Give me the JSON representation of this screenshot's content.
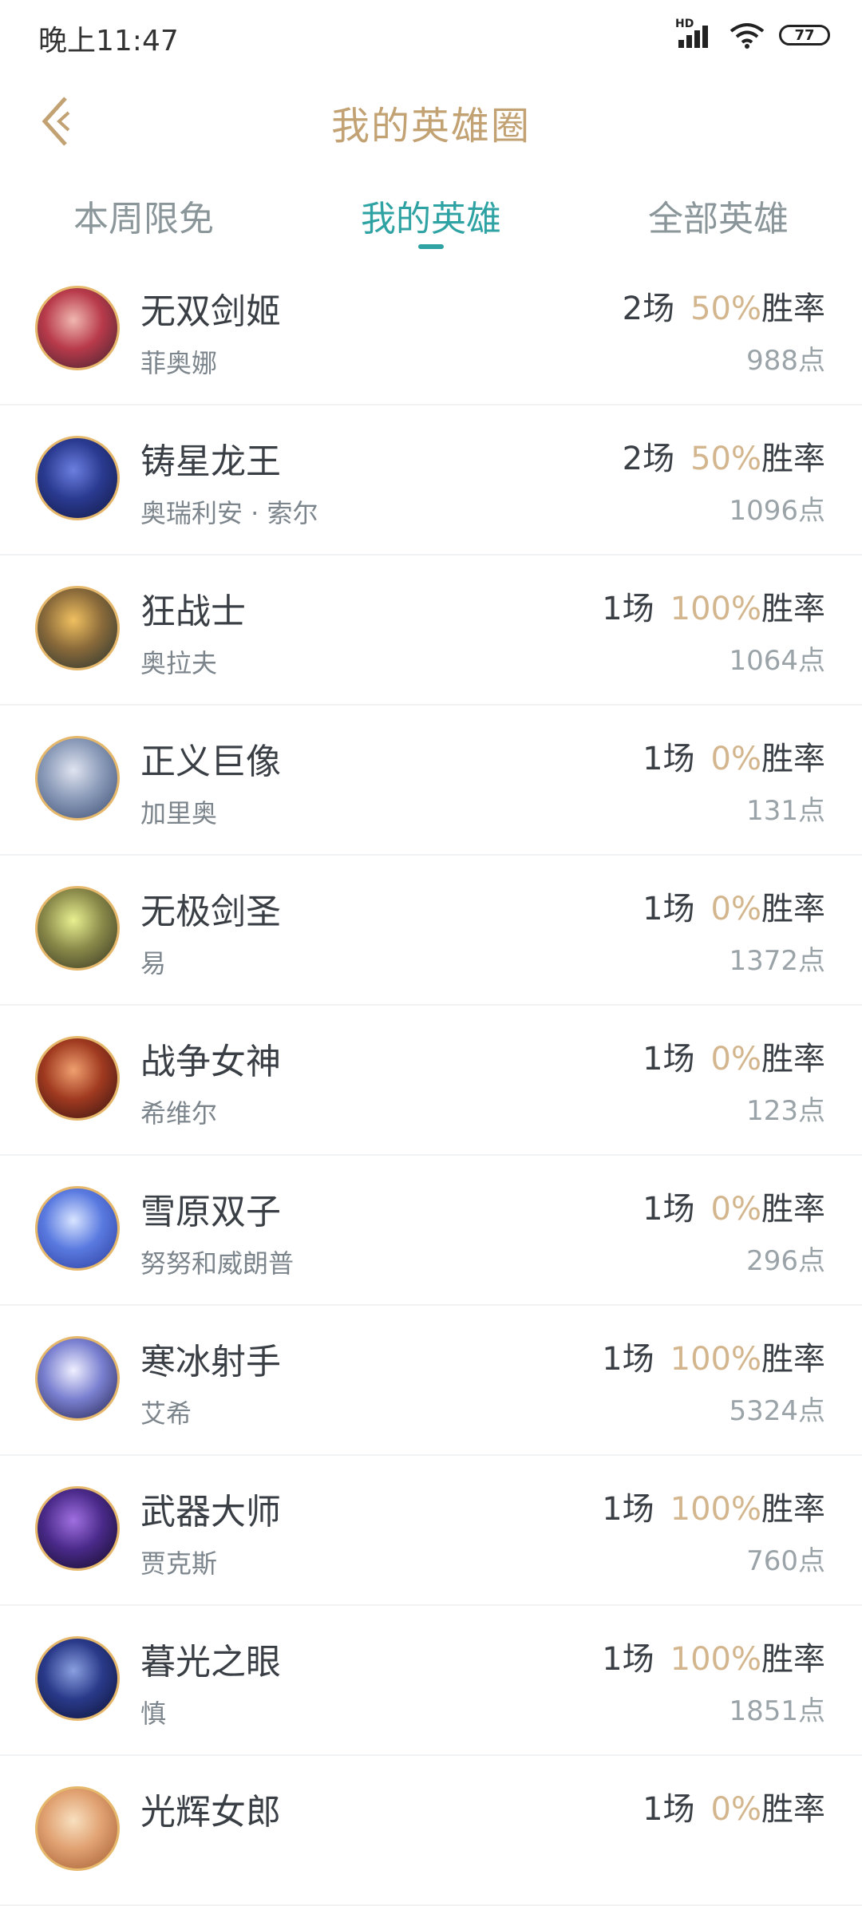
{
  "status_bar": {
    "time": "晚上11:47",
    "network_label": "HD",
    "battery": "77"
  },
  "header": {
    "title": "我的英雄圈"
  },
  "tabs": [
    {
      "label": "本周限免",
      "active": false
    },
    {
      "label": "我的英雄",
      "active": true
    },
    {
      "label": "全部英雄",
      "active": false
    }
  ],
  "stats_suffix": {
    "win_rate_label": "胜率"
  },
  "colors": {
    "accent_teal": "#2fa3a3",
    "accent_gold": "#c2a173",
    "rate_gold": "#d4b68e"
  },
  "heroes": [
    {
      "name": "无双剑姬",
      "sub": "菲奥娜",
      "games": "2场",
      "rate": "50%",
      "points": "988点",
      "avatar_colors": [
        "#f0b8b0",
        "#b83a4a",
        "#3a2230"
      ]
    },
    {
      "name": "铸星龙王",
      "sub": "奥瑞利安 · 索尔",
      "games": "2场",
      "rate": "50%",
      "points": "1096点",
      "avatar_colors": [
        "#6b7fe0",
        "#2a3a90",
        "#101840"
      ]
    },
    {
      "name": "狂战士",
      "sub": "奥拉夫",
      "games": "1场",
      "rate": "100%",
      "points": "1064点",
      "avatar_colors": [
        "#f0c060",
        "#8a6a3a",
        "#203030"
      ]
    },
    {
      "name": "正义巨像",
      "sub": "加里奥",
      "games": "1场",
      "rate": "0%",
      "points": "131点",
      "avatar_colors": [
        "#e0e4f0",
        "#8a9ab8",
        "#3a4a70"
      ]
    },
    {
      "name": "无极剑圣",
      "sub": "易",
      "games": "1场",
      "rate": "0%",
      "points": "1372点",
      "avatar_colors": [
        "#e8f090",
        "#8a8a4a",
        "#303020"
      ]
    },
    {
      "name": "战争女神",
      "sub": "希维尔",
      "games": "1场",
      "rate": "0%",
      "points": "123点",
      "avatar_colors": [
        "#f0a070",
        "#a03a20",
        "#301010"
      ]
    },
    {
      "name": "雪原双子",
      "sub": "努努和威朗普",
      "games": "1场",
      "rate": "0%",
      "points": "296点",
      "avatar_colors": [
        "#d8e4ff",
        "#5a7ae0",
        "#2a3a9a"
      ]
    },
    {
      "name": "寒冰射手",
      "sub": "艾希",
      "games": "1场",
      "rate": "100%",
      "points": "5324点",
      "avatar_colors": [
        "#f0f0ff",
        "#7a80d0",
        "#20204a"
      ]
    },
    {
      "name": "武器大师",
      "sub": "贾克斯",
      "games": "1场",
      "rate": "100%",
      "points": "760点",
      "avatar_colors": [
        "#a070e0",
        "#4a2a8a",
        "#100a20"
      ]
    },
    {
      "name": "暮光之眼",
      "sub": "慎",
      "games": "1场",
      "rate": "100%",
      "points": "1851点",
      "avatar_colors": [
        "#8aa0e0",
        "#2a3a8a",
        "#0a1030"
      ]
    },
    {
      "name": "光辉女郎",
      "sub": "",
      "games": "1场",
      "rate": "0%",
      "points": "",
      "avatar_colors": [
        "#f8e0c0",
        "#e0a070",
        "#a05a30"
      ]
    }
  ]
}
